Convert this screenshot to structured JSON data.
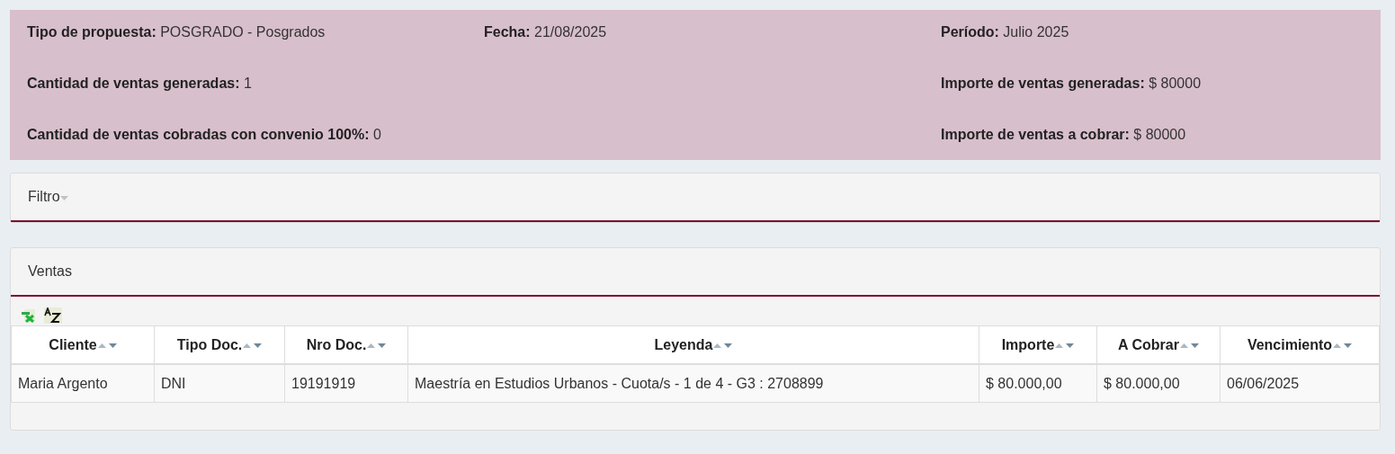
{
  "summary_rows": [
    {
      "left": {
        "label": "Tipo de propuesta:",
        "value": "POSGRADO - Posgrados"
      },
      "middle": {
        "label": "Fecha:",
        "value": "21/08/2025"
      },
      "right": {
        "label": "Período:",
        "value": "Julio 2025"
      }
    },
    {
      "left": {
        "label": "Cantidad de ventas generadas:",
        "value": "1"
      },
      "right": {
        "label": "Importe de ventas generadas:",
        "value": "$ 80000"
      }
    },
    {
      "left": {
        "label": "Cantidad de ventas cobradas con convenio 100%:",
        "value": "0"
      },
      "right": {
        "label": "Importe de ventas a cobrar:",
        "value": "$ 80000"
      }
    }
  ],
  "filter_panel": {
    "title": "Filtro",
    "expanded": false
  },
  "sales_panel": {
    "title": "Ventas",
    "table": {
      "columns": [
        "Cliente",
        "Tipo Doc.",
        "Nro Doc.",
        "Leyenda",
        "Importe",
        "A Cobrar",
        "Vencimiento"
      ],
      "rows": [
        [
          "Maria Argento",
          "DNI",
          "19191919",
          "Maestría en Estudios Urbanos - Cuota/s - 1 de 4 - G3 : 2708899",
          "$ 80.000,00",
          "$ 80.000,00",
          "06/06/2025"
        ]
      ]
    }
  }
}
